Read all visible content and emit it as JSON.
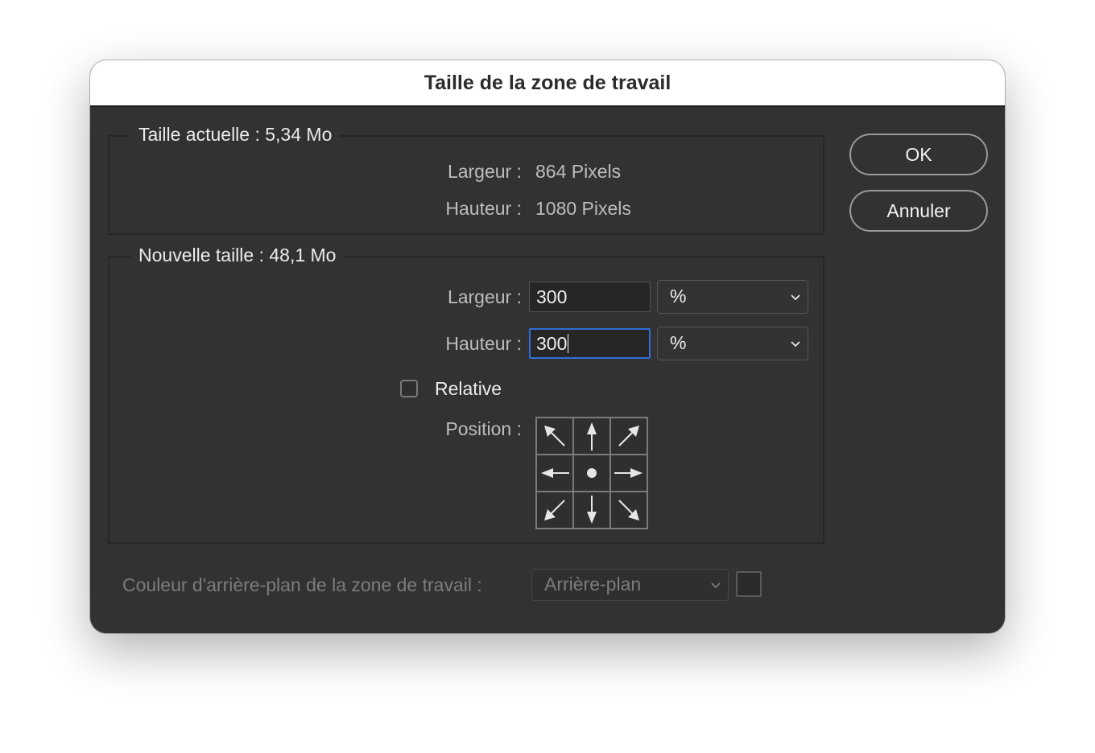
{
  "dialog": {
    "title": "Taille de la zone de travail"
  },
  "current_size": {
    "legend": "Taille actuelle : 5,34 Mo",
    "width_label": "Largeur :",
    "width_value": "864 Pixels",
    "height_label": "Hauteur :",
    "height_value": "1080 Pixels"
  },
  "new_size": {
    "legend": "Nouvelle taille : 48,1 Mo",
    "width_label": "Largeur :",
    "width_value": "300",
    "width_unit": "%",
    "height_label": "Hauteur :",
    "height_value": "300",
    "height_unit": "%",
    "relative_label": "Relative",
    "relative_checked": false,
    "position_label": "Position :",
    "anchor": "center",
    "anchor_icons": [
      "arrow-up-left-icon",
      "arrow-up-icon",
      "arrow-up-right-icon",
      "arrow-left-icon",
      "anchor-dot-icon",
      "arrow-right-icon",
      "arrow-down-left-icon",
      "arrow-down-icon",
      "arrow-down-right-icon"
    ]
  },
  "buttons": {
    "ok": "OK",
    "cancel": "Annuler"
  },
  "background": {
    "label": "Couleur d'arrière-plan de la zone de travail :",
    "value": "Arrière-plan",
    "enabled": false
  },
  "colors": {
    "dialog_bg": "#323232",
    "focus_ring": "#2f6fd8"
  }
}
